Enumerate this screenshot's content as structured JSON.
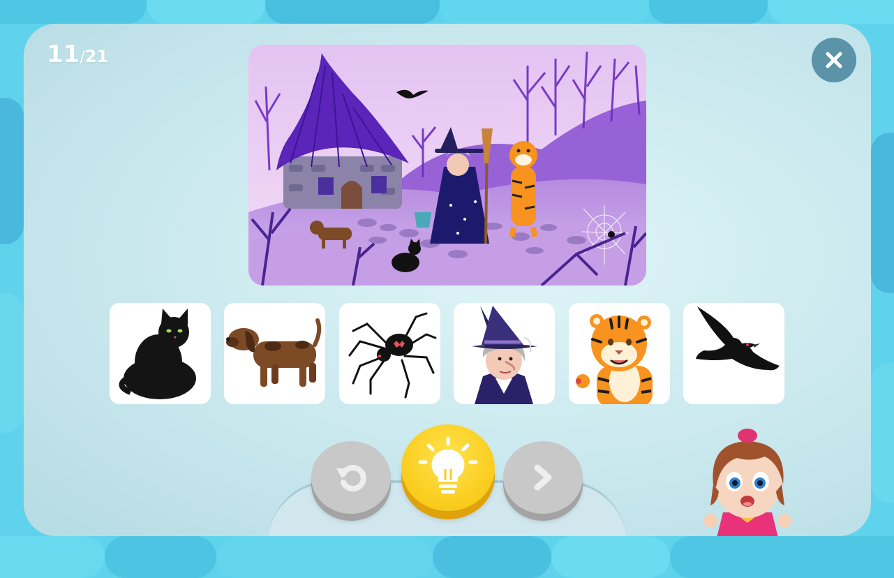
{
  "progress": {
    "current": "11",
    "separator": "/",
    "total": "21"
  },
  "colors": {
    "background": "#5fd3ec",
    "panel": "#c9e8ee",
    "close_button": "#5b93a8",
    "hint_button": "#f9cc1c",
    "disabled_button": "#c8c8c8"
  },
  "scene": {
    "icon": "witch-scene-illustration"
  },
  "cards": [
    {
      "icon": "black-cat-icon"
    },
    {
      "icon": "brown-dog-icon"
    },
    {
      "icon": "spider-icon"
    },
    {
      "icon": "witch-icon"
    },
    {
      "icon": "tiger-icon"
    },
    {
      "icon": "crow-icon"
    }
  ],
  "controls": {
    "replay": {
      "icon": "replay-icon",
      "enabled": false
    },
    "hint": {
      "icon": "lightbulb-icon",
      "enabled": true
    },
    "next": {
      "icon": "chevron-right-icon",
      "enabled": false
    },
    "close": {
      "icon": "close-icon"
    }
  },
  "mascot": {
    "icon": "girl-mascot"
  }
}
